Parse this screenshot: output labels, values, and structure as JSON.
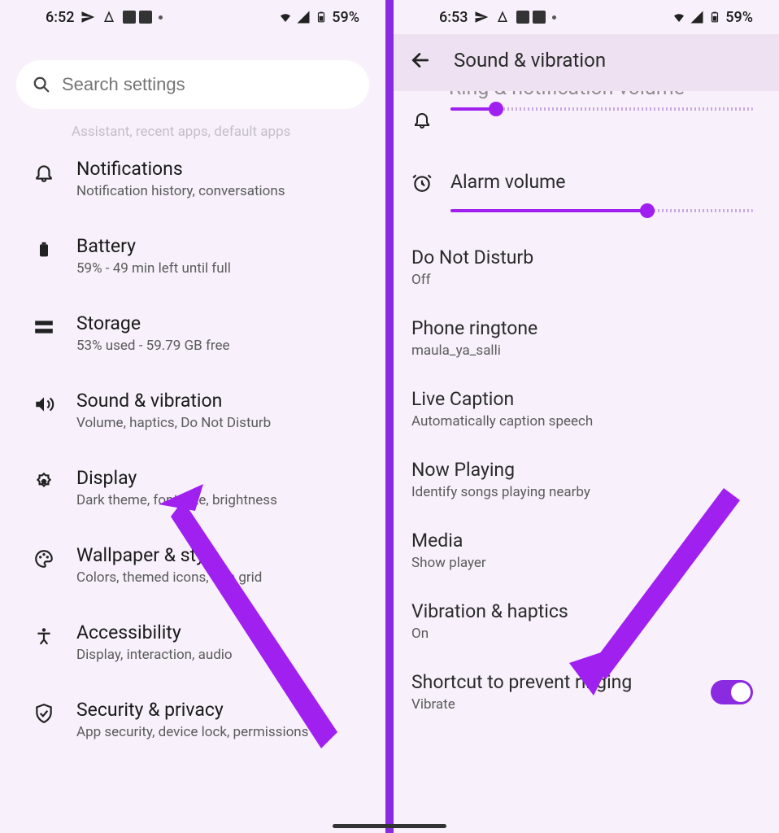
{
  "status": {
    "time_left": "6:52",
    "time_right": "6:53",
    "battery": "59%"
  },
  "search": {
    "placeholder": "Search settings"
  },
  "settings": {
    "partial": "Assistant, recent apps, default apps",
    "items": [
      {
        "title": "Notifications",
        "sub": "Notification history, conversations"
      },
      {
        "title": "Battery",
        "sub": "59% - 49 min left until full"
      },
      {
        "title": "Storage",
        "sub": "53% used - 59.79 GB free"
      },
      {
        "title": "Sound & vibration",
        "sub": "Volume, haptics, Do Not Disturb"
      },
      {
        "title": "Display",
        "sub": "Dark theme, font size, brightness"
      },
      {
        "title": "Wallpaper & style",
        "sub": "Colors, themed icons, app grid"
      },
      {
        "title": "Accessibility",
        "sub": "Display, interaction, audio"
      },
      {
        "title": "Security & privacy",
        "sub": "App security, device lock, permissions"
      }
    ]
  },
  "sound_page": {
    "title": "Sound & vibration",
    "partial_top": "Ring & notification volume",
    "sliders": [
      {
        "label": "Ring & notification volume",
        "value": 15
      },
      {
        "label": "Alarm volume",
        "value": 65
      }
    ],
    "items": [
      {
        "title": "Do Not Disturb",
        "sub": "Off"
      },
      {
        "title": "Phone ringtone",
        "sub": "maula_ya_salli"
      },
      {
        "title": "Live Caption",
        "sub": "Automatically caption speech"
      },
      {
        "title": "Now Playing",
        "sub": "Identify songs playing nearby"
      },
      {
        "title": "Media",
        "sub": "Show player"
      },
      {
        "title": "Vibration & haptics",
        "sub": "On"
      },
      {
        "title": "Shortcut to prevent ringing",
        "sub": "Vibrate",
        "toggle": true
      }
    ]
  }
}
